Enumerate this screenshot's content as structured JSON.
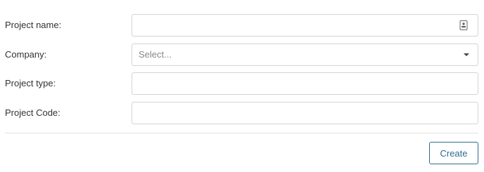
{
  "form": {
    "project_name": {
      "label": "Project name:",
      "value": "",
      "placeholder": "",
      "icon": "contact-card-icon"
    },
    "company": {
      "label": "Company:",
      "selected": "Select..."
    },
    "project_type": {
      "label": "Project type:",
      "value": "",
      "placeholder": ""
    },
    "project_code": {
      "label": "Project Code:",
      "value": "",
      "placeholder": ""
    },
    "create_label": "Create"
  },
  "colors": {
    "accent": "#2f6b8f",
    "border": "#d4d4d4",
    "divider": "#e2e2e2",
    "text": "#333333",
    "placeholder": "#888888"
  }
}
